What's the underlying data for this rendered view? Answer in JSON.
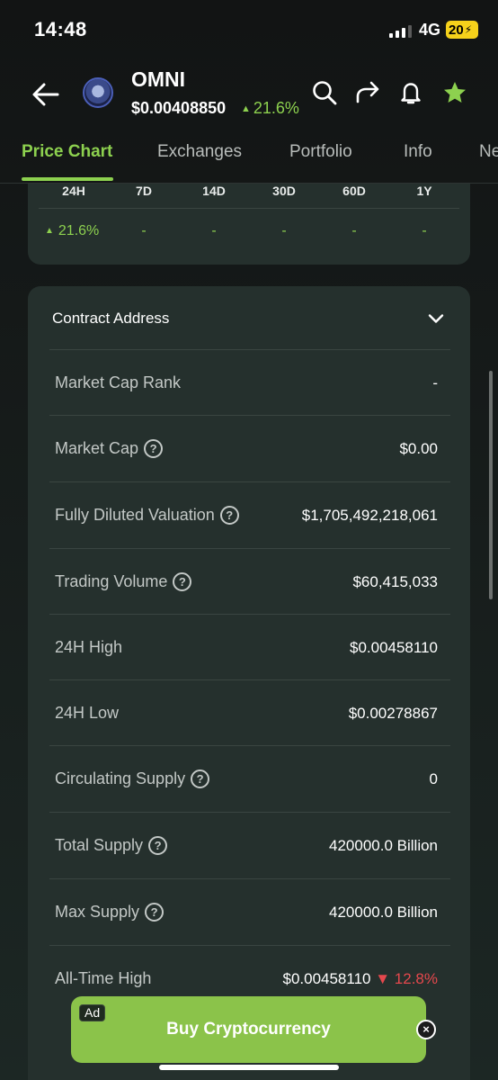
{
  "status_bar": {
    "time": "14:48",
    "network": "4G",
    "battery": "20"
  },
  "header": {
    "coin_name": "OMNI",
    "price": "$0.00408850",
    "change": "21.6%",
    "icons": [
      "back-arrow-icon",
      "search-icon",
      "share-icon",
      "bell-icon",
      "star-icon"
    ],
    "accent_color": "#8dd14f"
  },
  "tabs": [
    "Price Chart",
    "Exchanges",
    "Portfolio",
    "Info",
    "Ne"
  ],
  "performance": {
    "headers": [
      "24H",
      "7D",
      "14D",
      "30D",
      "60D",
      "1Y"
    ],
    "values": [
      "21.6%",
      "-",
      "-",
      "-",
      "-",
      "-"
    ]
  },
  "stats": {
    "contract_label": "Contract Address",
    "rows": [
      {
        "label": "Market Cap Rank",
        "value": "-",
        "help": false
      },
      {
        "label": "Market Cap",
        "value": "$0.00",
        "help": true
      },
      {
        "label": "Fully Diluted Valuation",
        "value": "$1,705,492,218,061",
        "help": true
      },
      {
        "label": "Trading Volume",
        "value": "$60,415,033",
        "help": true
      },
      {
        "label": "24H High",
        "value": "$0.00458110",
        "help": false
      },
      {
        "label": "24H Low",
        "value": "$0.00278867",
        "help": false
      },
      {
        "label": "Circulating Supply",
        "value": "0",
        "help": true
      },
      {
        "label": "Total Supply",
        "value": "420000.0 Billion",
        "help": true
      },
      {
        "label": "Max Supply",
        "value": "420000.0 Billion",
        "help": true
      },
      {
        "label": "All-Time High",
        "value": "$0.00458110",
        "extra": "12.8%",
        "help": false
      }
    ]
  },
  "ad": {
    "label": "Ad",
    "text": "Buy Cryptocurrency",
    "close": "×"
  }
}
